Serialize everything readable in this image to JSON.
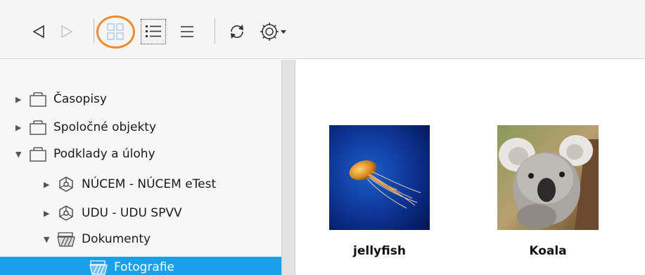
{
  "toolbar": {
    "back": "back-icon",
    "forward": "forward-icon",
    "views": [
      "grid-view-icon",
      "detail-list-view-icon",
      "list-view-icon"
    ],
    "refresh": "refresh-icon",
    "settings": "gear-icon",
    "settings_menu": "chevron-down-icon",
    "highlight_color": "#f08a2a"
  },
  "tree": {
    "items": [
      {
        "label": "Časopisy",
        "expanded": false
      },
      {
        "label": "Spoločné objekty",
        "expanded": false
      },
      {
        "label": "Podklady a úlohy",
        "expanded": true
      },
      {
        "label": "NÚCEM - NÚCEM eTest",
        "expanded": false
      },
      {
        "label": "UDU - UDU SPVV",
        "expanded": false
      },
      {
        "label": "Dokumenty",
        "expanded": true
      },
      {
        "label": "Fotografie",
        "selected": true
      }
    ],
    "selected_color": "#1aa0ea"
  },
  "content": {
    "items": [
      {
        "caption": "jellyfish"
      },
      {
        "caption": "Koala"
      }
    ]
  }
}
